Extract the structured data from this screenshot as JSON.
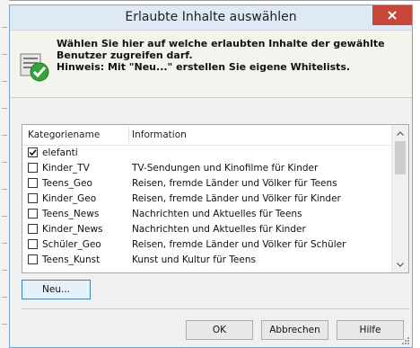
{
  "window": {
    "title": "Erlaubte Inhalte auswählen"
  },
  "header": {
    "line1": "Wählen Sie hier auf welche erlaubten Inhalte der gewählte",
    "line2": "Benutzer zugreifen darf.",
    "line3": "Hinweis: Mit \"Neu...\" erstellen Sie eigene Whitelists."
  },
  "list": {
    "columns": {
      "name": "Kategoriename",
      "info": "Information"
    },
    "rows": [
      {
        "name": "elefanti",
        "info": "",
        "checked": true
      },
      {
        "name": "Kinder_TV",
        "info": "TV-Sendungen und Kinofilme für Kinder",
        "checked": false
      },
      {
        "name": "Teens_Geo",
        "info": "Reisen, fremde Länder und Völker für Teens",
        "checked": false
      },
      {
        "name": "Kinder_Geo",
        "info": "Reisen, fremde Länder und Völker für Kinder",
        "checked": false
      },
      {
        "name": "Teens_News",
        "info": "Nachrichten und Aktuelles für Teens",
        "checked": false
      },
      {
        "name": "Kinder_News",
        "info": "Nachrichten und Aktuelles für Kinder",
        "checked": false
      },
      {
        "name": "Schüler_Geo",
        "info": "Reisen, fremde Länder und Völker für Schüler",
        "checked": false
      },
      {
        "name": "Teens_Kunst",
        "info": "Kunst und Kultur für Teens",
        "checked": false
      }
    ]
  },
  "buttons": {
    "new": "Neu...",
    "ok": "OK",
    "cancel": "Abbrechen",
    "help": "Hilfe"
  },
  "colors": {
    "close": "#c7463a",
    "titlebar": "#dfe9f5",
    "accent": "#3c7fb1"
  }
}
